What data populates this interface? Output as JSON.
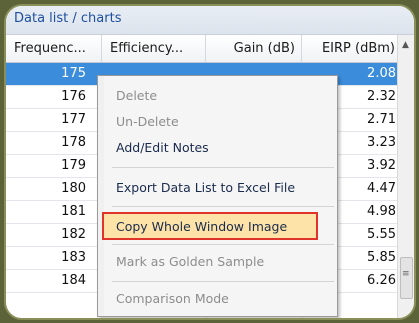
{
  "header": {
    "title": "Data list / charts"
  },
  "table": {
    "columns": [
      "Frequenc...",
      "Efficiency...",
      "Gain (dB)",
      "EIRP (dBm)"
    ],
    "rows": [
      {
        "freq": "175",
        "eirp": "2.08",
        "selected": true
      },
      {
        "freq": "176",
        "eirp": "2.32"
      },
      {
        "freq": "177",
        "eirp": "2.71"
      },
      {
        "freq": "178",
        "eirp": "3.23"
      },
      {
        "freq": "179",
        "eirp": "3.92"
      },
      {
        "freq": "180",
        "eirp": "4.47"
      },
      {
        "freq": "181",
        "eirp": "4.98"
      },
      {
        "freq": "182",
        "eirp": "5.55"
      },
      {
        "freq": "183",
        "eirp": "5.85"
      },
      {
        "freq": "184",
        "eirp": "6.26"
      }
    ]
  },
  "context_menu": {
    "delete": "Delete",
    "undelete": "Un-Delete",
    "add_edit_notes": "Add/Edit Notes",
    "export_excel": "Export Data List to Excel File",
    "copy_window_image": "Copy Whole Window Image",
    "mark_golden": "Mark as Golden Sample",
    "comparison_mode": "Comparison Mode"
  },
  "scrollbar": {
    "up_icon": "chevron-up-icon",
    "grip_icon": "grip-lines-icon"
  },
  "colors": {
    "selection": "#3b8ddc",
    "highlight_border": "#e0342a",
    "highlight_fill": "#fde3a7",
    "frame": "#5d6339"
  }
}
